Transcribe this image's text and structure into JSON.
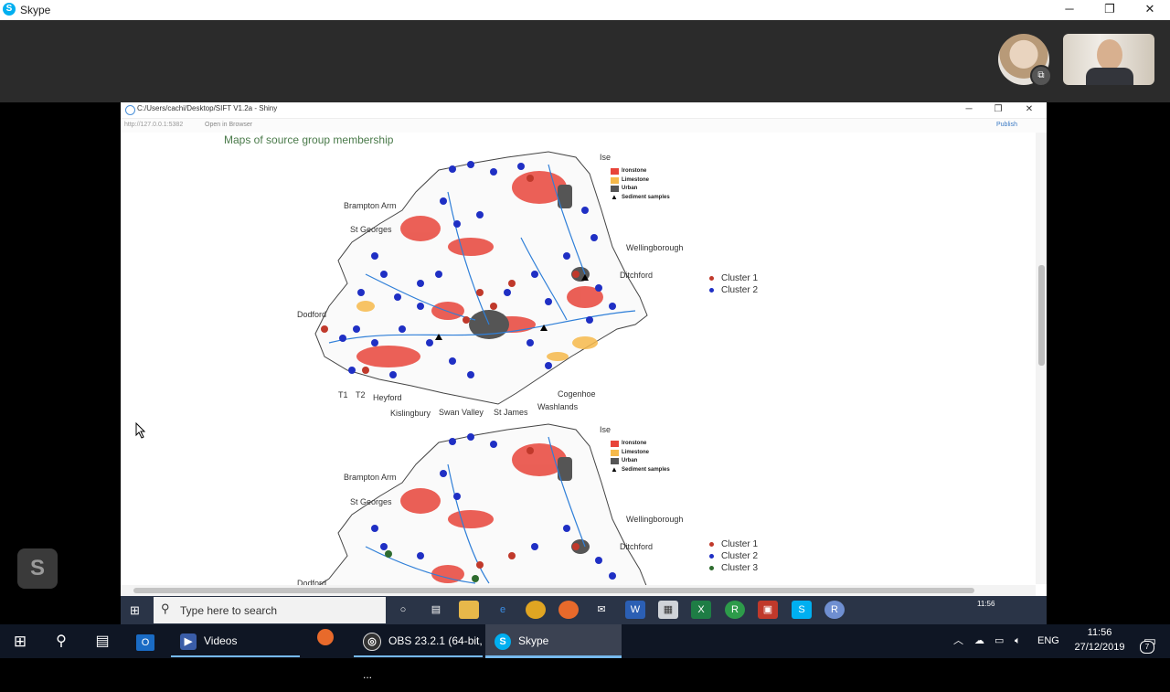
{
  "skype": {
    "title": "Skype",
    "logo_letter": "S",
    "window_controls": {
      "minimize": "─",
      "maximize": "❐",
      "close": "✕"
    },
    "floating_logo": "S"
  },
  "shiny": {
    "window_title": "C:/Users/cachi/Desktop/SIFT V1.2a - Shiny",
    "url": "http://127.0.0.1:5382",
    "open_in_browser": "Open in Browser",
    "publish": "Publish",
    "heading": "Maps of source group membership",
    "controls": {
      "minimize": "─",
      "maximize": "❐",
      "close": "✕"
    }
  },
  "map1": {
    "places": {
      "ise": "Ise",
      "brampton_arm": "Brampton Arm",
      "st_georges": "St Georges",
      "wellingborough": "Wellingborough",
      "ditchford": "Ditchford",
      "dodford": "Dodford",
      "t1": "T1",
      "t2": "T2",
      "heyford": "Heyford",
      "cogenhoe": "Cogenhoe",
      "kislingbury": "Kislingbury",
      "swan_valley": "Swan Valley",
      "st_james": "St James",
      "washlands": "Washlands"
    },
    "key": {
      "ironstone": "Ironstone",
      "limestone": "Limestone",
      "urban": "Urban",
      "sediment": "Sediment samples"
    },
    "legend": {
      "cluster1": "Cluster 1",
      "cluster2": "Cluster 2"
    }
  },
  "map2": {
    "places": {
      "ise": "Ise",
      "brampton_arm": "Brampton Arm",
      "st_georges": "St Georges",
      "wellingborough": "Wellingborough",
      "ditchford": "Ditchford",
      "dodford": "Dodford"
    },
    "key": {
      "ironstone": "Ironstone",
      "limestone": "Limestone",
      "urban": "Urban",
      "sediment": "Sediment samples"
    },
    "legend": {
      "cluster1": "Cluster 1",
      "cluster2": "Cluster 2",
      "cluster3": "Cluster 3"
    }
  },
  "colors": {
    "ironstone": "#e8443a",
    "limestone": "#f6b94a",
    "urban": "#555555",
    "cluster1": "#c0392b",
    "cluster2": "#1f2fc4",
    "cluster3": "#2e6b2e",
    "river": "#2f7fd8"
  },
  "inner_taskbar": {
    "search_placeholder": "Type here to search",
    "time": "11:56",
    "icons": [
      "cortana-icon",
      "task-view-icon",
      "file-explorer-icon",
      "edge-icon",
      "chrome-icon",
      "firefox-icon",
      "mail-icon",
      "word-icon",
      "powerpoint-icon",
      "excel-icon",
      "r-icon",
      "pdf-icon",
      "skype-icon",
      "rstudio-icon"
    ]
  },
  "taskbar": {
    "apps": {
      "videos": "Videos",
      "obs": "OBS 23.2.1 (64-bit, ...",
      "skype": "Skype"
    },
    "language": "ENG",
    "time": "11:56",
    "date": "27/12/2019",
    "notifications": "7"
  }
}
